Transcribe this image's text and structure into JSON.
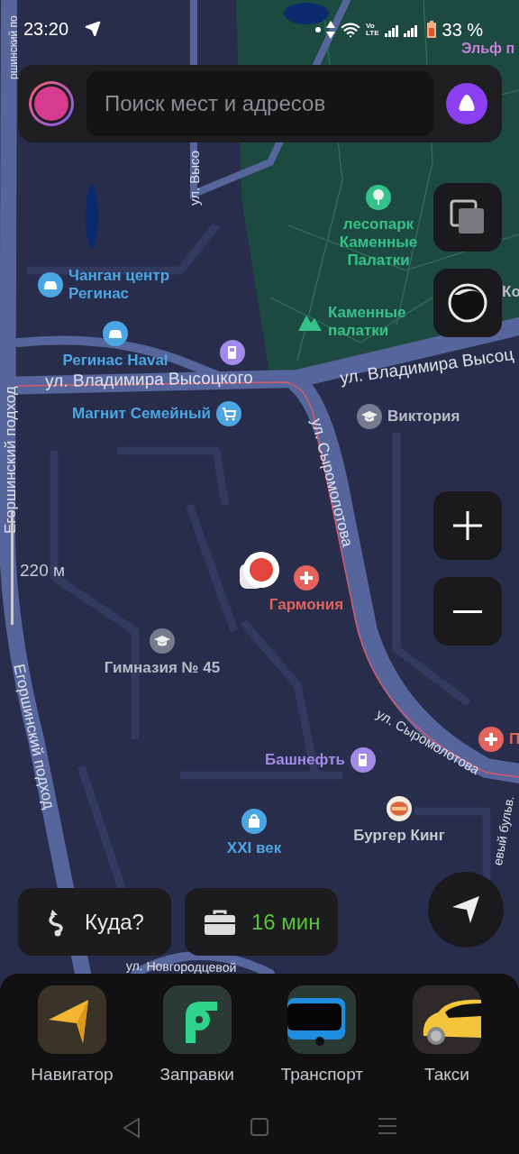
{
  "status_bar": {
    "time": "23:20",
    "volte": [
      "Vo",
      "LTE"
    ],
    "battery": "33 %"
  },
  "search": {
    "placeholder": "Поиск мест и адресов"
  },
  "map": {
    "scale": "220 м",
    "places": [
      {
        "text": "Эльф п",
        "kind": "none",
        "color": "#c97fdc"
      },
      {
        "text": "лесопарк Каменные Палатки",
        "kind": "tree",
        "color": "#35c28a"
      },
      {
        "text": "Ко",
        "kind": "none",
        "color": "#b9bcc8"
      },
      {
        "text": "Каменные палатки",
        "kind": "mountain",
        "color": "#35c28a"
      },
      {
        "text": "Чанган центр Регинас",
        "kind": "car",
        "color": "#4ca6e4"
      },
      {
        "text": "Регинас Haval",
        "kind": "car",
        "color": "#4ca6e4"
      },
      {
        "kind": "fuel",
        "color": "#a18ae8"
      },
      {
        "text": "Магнит Семейный",
        "kind": "cart",
        "color": "#4ca6e4"
      },
      {
        "text": "Виктория",
        "kind": "school",
        "color": "#b9bcc8"
      },
      {
        "text": "Гармония",
        "kind": "plus",
        "color": "#e5635d"
      },
      {
        "text": "Гимназия № 45",
        "kind": "school",
        "color": "#b9bcc8"
      },
      {
        "text": "П",
        "kind": "plus",
        "color": "#e5635d"
      },
      {
        "text": "Башнефть",
        "kind": "fuel",
        "color": "#a18ae8"
      },
      {
        "text": "Бургер Кинг",
        "kind": "burger",
        "color": "#c6c8d2"
      },
      {
        "text": "XXI век",
        "kind": "shop",
        "color": "#4ca6e4"
      }
    ],
    "streets": [
      "ршинский по",
      "Егоршинский подход",
      "Егоршинский подход",
      "ул. Высо",
      "ул. Владимира Высоцкого",
      "ул. Владимира Высоц",
      "ул. Сыромолотова",
      "ул. Сыромолотова",
      "ул. Новгородцевой",
      "евый бульв."
    ]
  },
  "route_button": "Куда?",
  "commute": {
    "time": "16 мин"
  },
  "apps": [
    {
      "label": "Навигатор",
      "kind": "navigator"
    },
    {
      "label": "Заправки",
      "kind": "fuel"
    },
    {
      "label": "Транспорт",
      "kind": "transport"
    },
    {
      "label": "Такси",
      "kind": "taxi"
    }
  ]
}
